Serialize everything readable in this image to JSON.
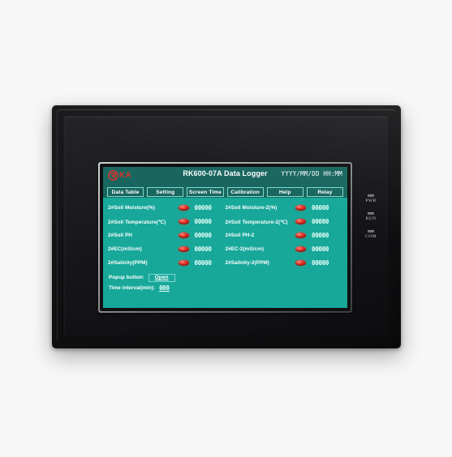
{
  "device": {
    "indicators": [
      {
        "label": "PWR"
      },
      {
        "label": "RUN"
      },
      {
        "label": "COM"
      }
    ]
  },
  "screen": {
    "header": {
      "logo_text": "KA",
      "logo_mark": "rika-circle-logo",
      "title": "RK600-07A Data Logger",
      "datetime_format": "YYYY/MM/DD HH:MM"
    },
    "tabs": [
      {
        "label": "Data Table",
        "active": true
      },
      {
        "label": "Setting",
        "active": false
      },
      {
        "label": "Screen Time",
        "active": false
      },
      {
        "label": "Calibration",
        "active": false
      },
      {
        "label": "Help",
        "active": false
      },
      {
        "label": "Relay",
        "active": false
      }
    ],
    "rows": [
      {
        "left": {
          "label": "2#Soil Moisture(%)",
          "led": "red-indicator",
          "value": "00000"
        },
        "right": {
          "label": "2#Soil Moisture-2(%)",
          "led": "red-indicator",
          "value": "00000"
        }
      },
      {
        "left": {
          "label": "2#Soil Temperature(℃)",
          "led": "red-indicator",
          "value": "00000"
        },
        "right": {
          "label": "2#Soil Temperature-2(℃)",
          "led": "red-indicator",
          "value": "00000"
        }
      },
      {
        "left": {
          "label": "2#Soil PH",
          "led": "red-indicator",
          "value": "00000"
        },
        "right": {
          "label": "2#Soil PH-2",
          "led": "red-indicator",
          "value": "00000"
        }
      },
      {
        "left": {
          "label": "2#EC(mS/cm)",
          "led": "red-indicator",
          "value": "00000"
        },
        "right": {
          "label": "2#EC-2(mS/cm)",
          "led": "red-indicator",
          "value": "00000"
        }
      },
      {
        "left": {
          "label": "2#Salinity(PPM)",
          "led": "red-indicator",
          "value": "00000"
        },
        "right": {
          "label": "2#Salinity-2(PPM)",
          "led": "red-indicator",
          "value": "00000"
        }
      }
    ],
    "controls": {
      "popup_label": "Popup button:",
      "popup_button": "Open",
      "interval_label": "Time interval(min):",
      "interval_value": "000"
    },
    "colors": {
      "lcd_background": "#17a89a",
      "lcd_header": "#18665f",
      "text": "#ffffff",
      "led_red": "#e53228",
      "logo_red": "#d8342c",
      "border_light": "#7fd8d0"
    }
  }
}
